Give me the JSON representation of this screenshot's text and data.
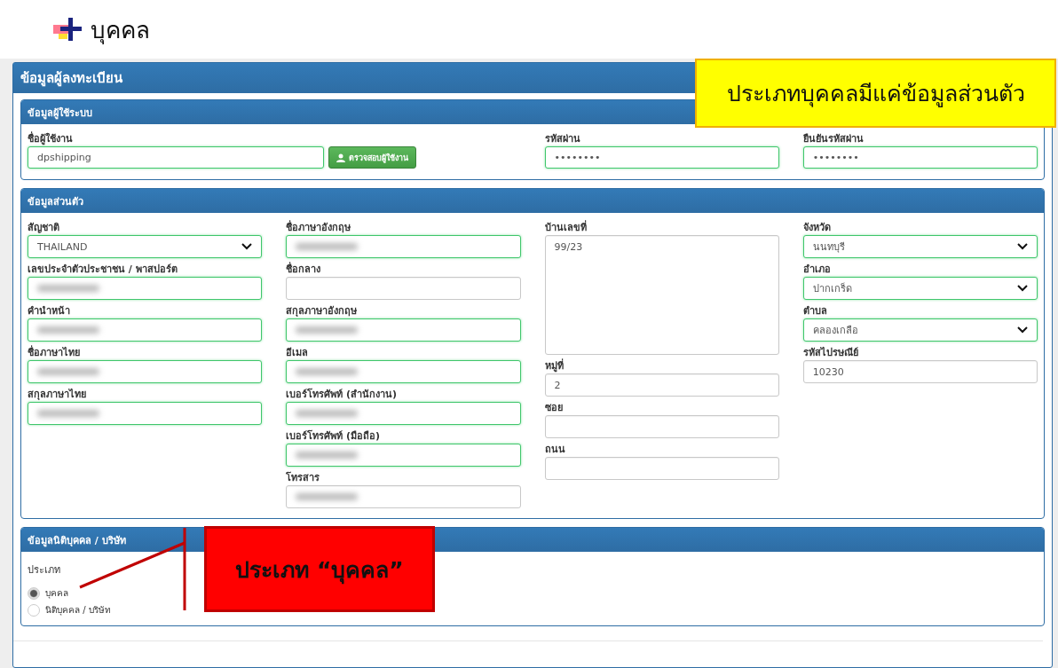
{
  "page_title": "บุคคล",
  "form": {
    "title": "ข้อมูลผู้ลงทะเบียน",
    "account": {
      "title": "ข้อมูลผู้ใช้ระบบ",
      "username": {
        "label": "ชื่อผู้ใช้งาน",
        "value": "dpshipping",
        "valid": true
      },
      "check_button": "ตรวจสอบผู้ใช้งาน",
      "password": {
        "label": "รหัสผ่าน",
        "value": "••••••••",
        "valid": true
      },
      "confirm_password": {
        "label": "ยืนยันรหัสผ่าน",
        "value": "••••••••",
        "valid": true
      }
    },
    "personal": {
      "title": "ข้อมูลส่วนตัว",
      "columns": [
        [
          {
            "kind": "select",
            "label": "สัญชาติ",
            "value": "THAILAND",
            "valid": true
          },
          {
            "kind": "text",
            "label": "เลขประจำตัวประชาชน / พาสปอร์ต",
            "valid": true,
            "blurred": true
          },
          {
            "kind": "text",
            "label": "คำนำหน้า",
            "valid": true,
            "blurred": true
          },
          {
            "kind": "text",
            "label": "ชื่อภาษาไทย",
            "valid": true,
            "blurred": true
          },
          {
            "kind": "text",
            "label": "สกุลภาษาไทย",
            "valid": true,
            "blurred": true
          }
        ],
        [
          {
            "kind": "text",
            "label": "ชื่อภาษาอังกฤษ",
            "valid": true,
            "blurred": true
          },
          {
            "kind": "text",
            "label": "ชื่อกลาง",
            "valid": false
          },
          {
            "kind": "text",
            "label": "สกุลภาษาอังกฤษ",
            "valid": true,
            "blurred": true
          },
          {
            "kind": "text",
            "label": "อีเมล",
            "valid": true,
            "blurred": true
          },
          {
            "kind": "text",
            "label": "เบอร์โทรศัพท์ (สำนักงาน)",
            "valid": true,
            "blurred": true
          },
          {
            "kind": "text",
            "label": "เบอร์โทรศัพท์ (มือถือ)",
            "valid": true,
            "blurred": true
          },
          {
            "kind": "text",
            "label": "โทรสาร",
            "valid": false,
            "blurred": true
          }
        ],
        [
          {
            "kind": "textarea",
            "label": "บ้านเลขที่",
            "value": "99/23",
            "valid": false
          },
          {
            "kind": "text",
            "label": "หมู่ที่",
            "value": "2",
            "valid": false
          },
          {
            "kind": "text",
            "label": "ซอย",
            "valid": false
          },
          {
            "kind": "text",
            "label": "ถนน",
            "valid": false
          }
        ],
        [
          {
            "kind": "select",
            "label": "จังหวัด",
            "value": "นนทบุรี",
            "valid": true
          },
          {
            "kind": "select",
            "label": "อำเภอ",
            "value": "ปากเกร็ด",
            "valid": true
          },
          {
            "kind": "select",
            "label": "ตำบล",
            "value": "คลองเกลือ",
            "valid": true
          },
          {
            "kind": "text",
            "label": "รหัสไปรษณีย์",
            "value": "10230",
            "valid": false
          }
        ]
      ]
    },
    "juristic": {
      "title": "ข้อมูลนิติบุคคล / บริษัท",
      "type_label": "ประเภท",
      "options": [
        {
          "label": "บุคคล",
          "selected": true
        },
        {
          "label": "นิติบุคคล / บริษัท",
          "selected": false
        }
      ]
    }
  },
  "callouts": [
    {
      "kind": "note",
      "text": "ประเภทบุคคลมีแค่ข้อมูลส่วนตัว"
    },
    {
      "kind": "alert",
      "text": "ประเภท “บุคคล”"
    }
  ]
}
